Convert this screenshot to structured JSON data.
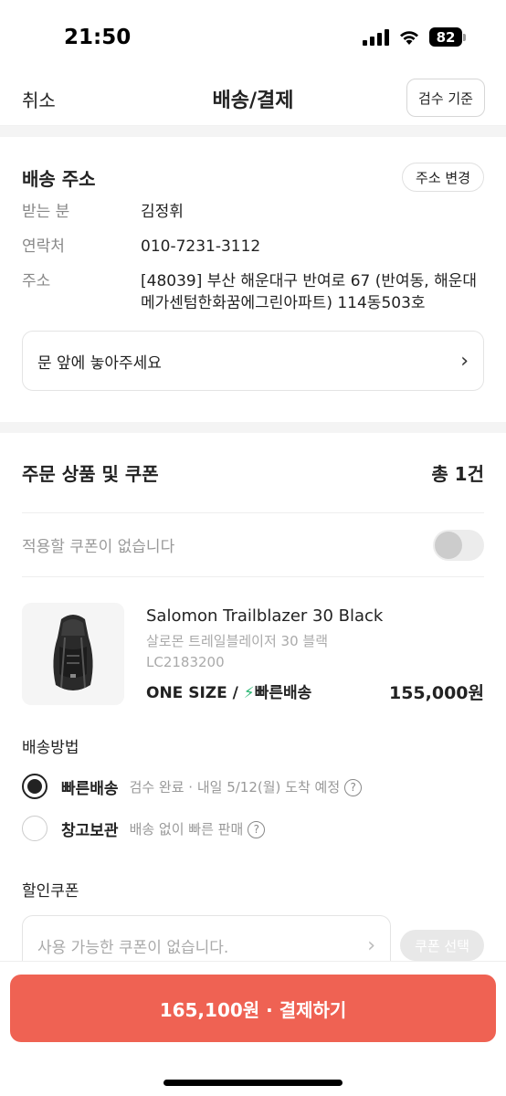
{
  "status": {
    "time": "21:50",
    "battery": "82"
  },
  "nav": {
    "cancel": "취소",
    "title": "배송/결제",
    "right_button": "검수 기준"
  },
  "address": {
    "title": "배송 주소",
    "change_button": "주소 변경",
    "rows": [
      {
        "label": "받는 분",
        "value": "김정휘"
      },
      {
        "label": "연락처",
        "value": "010-7231-3112"
      },
      {
        "label": "주소",
        "value": "[48039] 부산 해운대구 반여로 67 (반여동, 해운대메가센텀한화꿈에그린아파트) 114동503호"
      }
    ],
    "memo": "문 앞에 놓아주세요"
  },
  "order": {
    "title": "주문 상품 및 쿠폰",
    "count": "총 1건",
    "coupon_toggle_label": "적용할 쿠폰이 없습니다",
    "coupon_toggle_on": false
  },
  "product": {
    "name": "Salomon Trailblazer 30 Black",
    "name_ko": "살로몬 트레일블레이저 30 블랙",
    "code": "LC2183200",
    "size": "ONE SIZE /",
    "fast_label": "빠른배송",
    "price": "155,000원"
  },
  "shipping": {
    "title": "배송방법",
    "options": [
      {
        "name": "빠른배송",
        "desc": "검수 완료 · 내일 5/12(월) 도착 예정",
        "selected": true
      },
      {
        "name": "창고보관",
        "desc": "배송 없이 빠른 판매",
        "selected": false
      }
    ]
  },
  "discount": {
    "title": "할인쿠폰",
    "placeholder": "사용 가능한 쿠폰이 없습니다.",
    "button": "쿠폰 선택"
  },
  "pay": {
    "button": "165,100원 · 결제하기"
  },
  "colors": {
    "accent": "#ef6253",
    "fast_bolt": "#2bb673"
  },
  "icons": {
    "memo_chevron": "chevron-right-icon",
    "help": "question-circle-icon",
    "fast": "lightning-icon"
  }
}
